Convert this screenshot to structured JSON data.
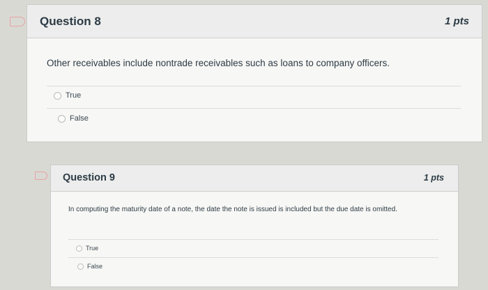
{
  "questions": [
    {
      "title": "Question 8",
      "points": "1 pts",
      "text": "Other receivables include nontrade receivables such as loans to company officers.",
      "answers": [
        "True",
        "False"
      ]
    },
    {
      "title": "Question 9",
      "points": "1 pts",
      "text": "In computing the maturity date of a note, the date the note is issued is included but the due date is omitted.",
      "answers": [
        "True",
        "False"
      ]
    }
  ],
  "colors": {
    "flag": "#e6a3a3",
    "header_bg": "#ecedec",
    "card_bg": "#f7f7f5",
    "text": "#2d3b45"
  }
}
